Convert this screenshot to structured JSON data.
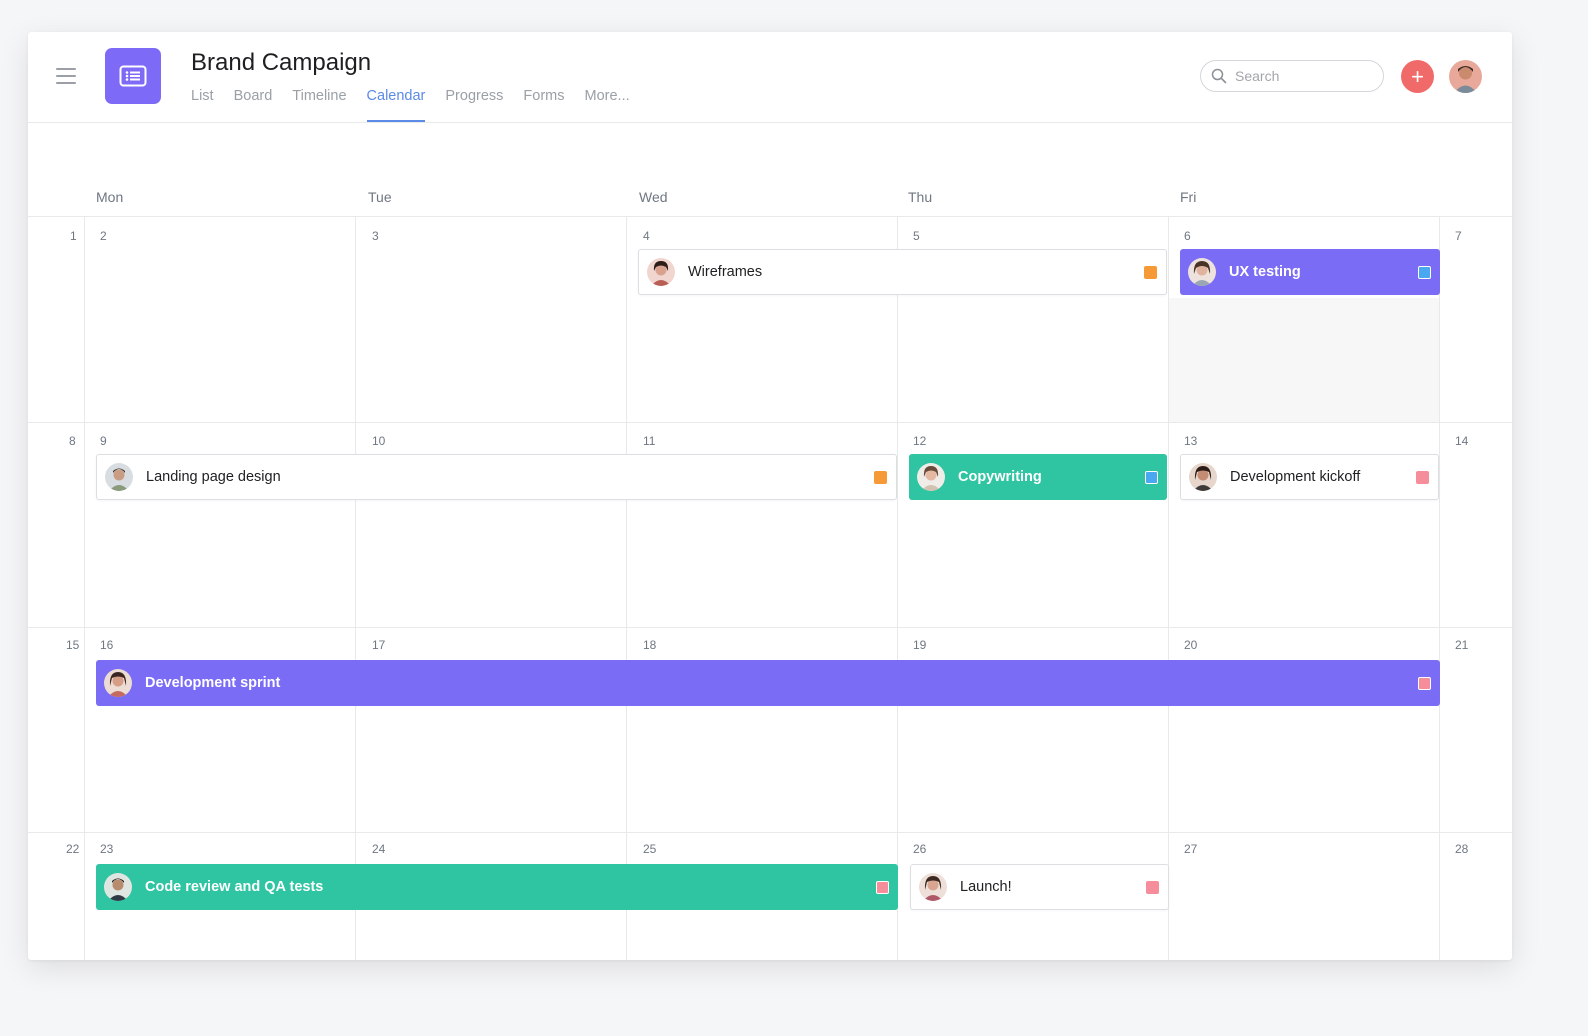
{
  "header": {
    "title": "Brand Campaign",
    "tabs": [
      {
        "label": "List",
        "active": false
      },
      {
        "label": "Board",
        "active": false
      },
      {
        "label": "Timeline",
        "active": false
      },
      {
        "label": "Calendar",
        "active": true
      },
      {
        "label": "Progress",
        "active": false
      },
      {
        "label": "Forms",
        "active": false
      },
      {
        "label": "More...",
        "active": false
      }
    ],
    "search_placeholder": "Search",
    "add_button": "+"
  },
  "calendar": {
    "weekdays": [
      "Mon",
      "Tue",
      "Wed",
      "Thu",
      "Fri"
    ],
    "weeks": [
      {
        "days": [
          "1",
          "2",
          "3",
          "4",
          "5",
          "6",
          "7"
        ]
      },
      {
        "days": [
          "8",
          "9",
          "10",
          "11",
          "12",
          "13",
          "14"
        ]
      },
      {
        "days": [
          "15",
          "16",
          "17",
          "18",
          "19",
          "20",
          "21"
        ]
      },
      {
        "days": [
          "22",
          "23",
          "24",
          "25",
          "26",
          "27",
          "28"
        ]
      }
    ],
    "events": [
      {
        "label": "Wireframes",
        "style": "white",
        "tag_color": "#f59a36"
      },
      {
        "label": "UX testing",
        "style": "purple",
        "tag_color": "#4aa8f0"
      },
      {
        "label": "Landing page design",
        "style": "white",
        "tag_color": "#f59a36"
      },
      {
        "label": "Copywriting",
        "style": "teal",
        "tag_color": "#4aa8f0"
      },
      {
        "label": "Development kickoff",
        "style": "white",
        "tag_color": "#f58d9a"
      },
      {
        "label": "Development sprint",
        "style": "purple",
        "tag_color": "#f58d9a"
      },
      {
        "label": "Code review and QA tests",
        "style": "teal",
        "tag_color": "#f58d9a"
      },
      {
        "label": "Launch!",
        "style": "white",
        "tag_color": "#f58d9a"
      }
    ]
  },
  "colors": {
    "accent": "#5b8be6",
    "project_icon": "#7d6bf7",
    "purple_event": "#7b6cf6",
    "teal_event": "#2fc4a2",
    "add_button": "#f06a6a"
  },
  "icons": [
    "menu-icon",
    "project-list-icon",
    "search-icon",
    "plus-icon",
    "user-avatar"
  ]
}
